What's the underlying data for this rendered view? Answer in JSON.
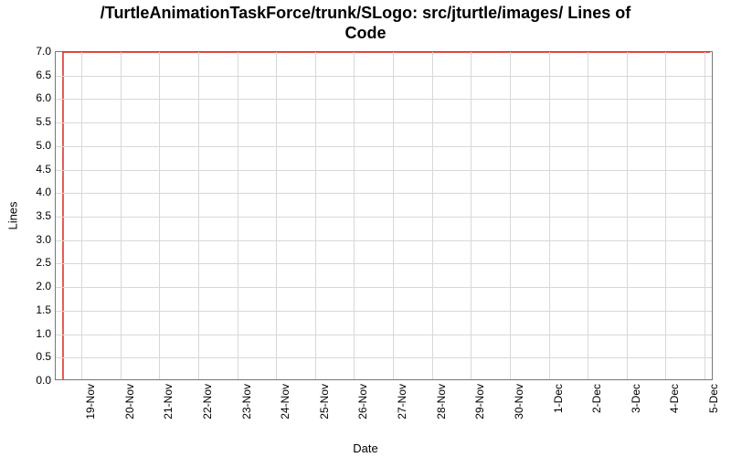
{
  "title_line1": "/TurtleAnimationTaskForce/trunk/SLogo: src/jturtle/images/ Lines of",
  "title_line2": "Code",
  "chart_data": {
    "type": "line",
    "title": "/TurtleAnimationTaskForce/trunk/SLogo: src/jturtle/images/ Lines of Code",
    "xlabel": "Date",
    "ylabel": "Lines",
    "ylim": [
      0.0,
      7.0
    ],
    "y_ticks": [
      0.0,
      0.5,
      1.0,
      1.5,
      2.0,
      2.5,
      3.0,
      3.5,
      4.0,
      4.5,
      5.0,
      5.5,
      6.0,
      6.5,
      7.0
    ],
    "y_tick_labels": [
      "0.0",
      "0.5",
      "1.0",
      "1.5",
      "2.0",
      "2.5",
      "3.0",
      "3.5",
      "4.0",
      "4.5",
      "5.0",
      "5.5",
      "6.0",
      "6.5",
      "7.0"
    ],
    "x_tick_labels": [
      "19-Nov",
      "20-Nov",
      "21-Nov",
      "22-Nov",
      "23-Nov",
      "24-Nov",
      "25-Nov",
      "26-Nov",
      "27-Nov",
      "28-Nov",
      "29-Nov",
      "30-Nov",
      "1-Dec",
      "2-Dec",
      "3-Dec",
      "4-Dec",
      "5-Dec"
    ],
    "series": [
      {
        "name": "Lines",
        "color": "#e2231a",
        "x": [
          "18-Nov-start",
          "18-Nov-jump",
          "5-Dec"
        ],
        "values": [
          0,
          7,
          7
        ]
      }
    ],
    "grid": true
  }
}
